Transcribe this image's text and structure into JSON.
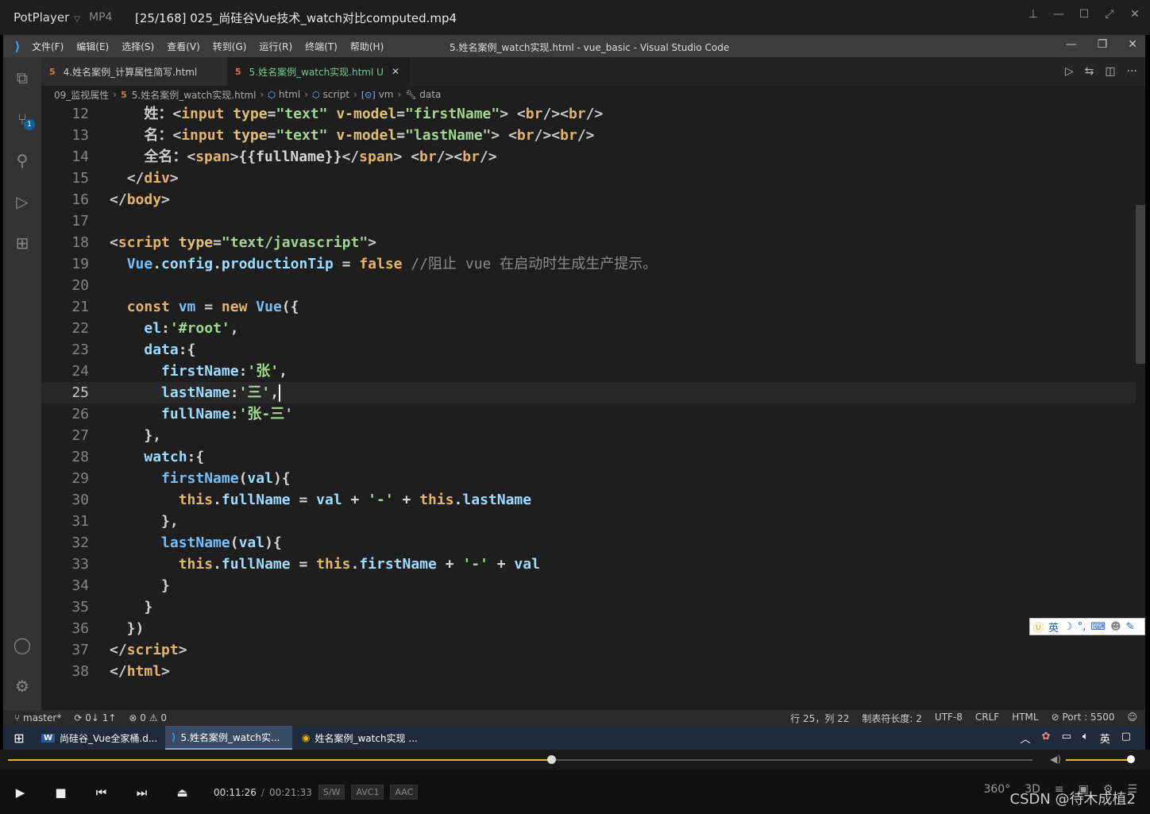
{
  "potplayer": {
    "app_name": "PotPlayer",
    "format": "MP4",
    "file_title": "[25/168] 025_尚硅谷Vue技术_watch对比computed.mp4",
    "current_time": "00:11:26",
    "time_separator": "/",
    "total_time": "00:21:33",
    "codec_badges": [
      "S/W",
      "AVC1",
      "AAC"
    ],
    "progress_fraction": 0.53,
    "volume_fraction": 1.0,
    "right_controls": [
      "360°",
      "3D"
    ]
  },
  "vscode": {
    "menu": [
      "文件(F)",
      "编辑(E)",
      "选择(S)",
      "查看(V)",
      "转到(G)",
      "运行(R)",
      "终端(T)",
      "帮助(H)"
    ],
    "window_title": "5.姓名案例_watch实现.html - vue_basic - Visual Studio Code",
    "tabs": [
      {
        "label": "4.姓名案例_计算属性简写.html",
        "active": false
      },
      {
        "label": "5.姓名案例_watch实现.html U",
        "active": true
      }
    ],
    "breadcrumb": [
      "09_监视属性",
      "5.姓名案例_watch实现.html",
      "html",
      "script",
      "vm",
      "data"
    ],
    "scm_badge": "1",
    "status": {
      "branch": "master*",
      "sync": "0↓ 1↑",
      "errors": "0",
      "warnings": "0",
      "position": "行 25，列 22",
      "indent": "制表符长度: 2",
      "encoding": "UTF-8",
      "eol": "CRLF",
      "language": "HTML",
      "port": "Port : 5500"
    },
    "current_line": 25
  },
  "ime": {
    "label": "英"
  },
  "taskbar": {
    "items": [
      {
        "label": "尚硅谷_Vue全家桶.d...",
        "icon": "word-icon"
      },
      {
        "label": "5.姓名案例_watch实...",
        "icon": "vscode-icon"
      },
      {
        "label": "姓名案例_watch实现 ...",
        "icon": "chrome-icon"
      }
    ],
    "tray_lang": "英"
  },
  "watermark": "CSDN @待木成植2",
  "code_lines": [
    {
      "n": 12,
      "html": "    <span class='tg'>姓：</span><span class='tg'>&lt;</span><span class='tn'>input</span> <span class='at'>type</span>=<span class='st'>\"text\"</span> <span class='at'>v-model</span>=<span class='st'>\"firstName\"</span><span class='tg'>&gt;</span> <span class='tg'>&lt;</span><span class='tn'>br</span><span class='tg'>/&gt;&lt;</span><span class='tn'>br</span><span class='tg'>/&gt;</span>"
    },
    {
      "n": 13,
      "html": "    <span class='tg'>名：</span><span class='tg'>&lt;</span><span class='tn'>input</span> <span class='at'>type</span>=<span class='st'>\"text\"</span> <span class='at'>v-model</span>=<span class='st'>\"lastName\"</span><span class='tg'>&gt;</span> <span class='tg'>&lt;</span><span class='tn'>br</span><span class='tg'>/&gt;&lt;</span><span class='tn'>br</span><span class='tg'>/&gt;</span>"
    },
    {
      "n": 14,
      "html": "    <span class='tg'>全名：</span><span class='tg'>&lt;</span><span class='tn'>span</span><span class='tg'>&gt;</span>{{fullName}}<span class='tg'>&lt;/</span><span class='tn'>span</span><span class='tg'>&gt;</span> <span class='tg'>&lt;</span><span class='tn'>br</span><span class='tg'>/&gt;&lt;</span><span class='tn'>br</span><span class='tg'>/&gt;</span>"
    },
    {
      "n": 15,
      "html": "  <span class='tg'>&lt;/</span><span class='tn'>div</span><span class='tg'>&gt;</span>"
    },
    {
      "n": 16,
      "html": "<span class='tg'>&lt;/</span><span class='tn'>body</span><span class='tg'>&gt;</span>"
    },
    {
      "n": 17,
      "html": ""
    },
    {
      "n": 18,
      "html": "<span class='tg'>&lt;</span><span class='tn'>script</span> <span class='at'>type</span>=<span class='st'>\"text/javascript\"</span><span class='tg'>&gt;</span>"
    },
    {
      "n": 19,
      "html": "  <span class='vr'>Vue</span>.<span class='pr'>config</span>.<span class='pr'>productionTip</span> = <span class='kw'>false</span> <span class='cm'>//阻止 vue 在启动时生成生产提示。</span>"
    },
    {
      "n": 20,
      "html": ""
    },
    {
      "n": 21,
      "html": "  <span class='kw'>const</span> <span class='vr'>vm</span> = <span class='kw'>new</span> <span class='fn'>Vue</span>({"
    },
    {
      "n": 22,
      "html": "    <span class='pr'>el</span>:<span class='st'>'#root'</span>,"
    },
    {
      "n": 23,
      "html": "    <span class='pr'>data</span>:{"
    },
    {
      "n": 24,
      "html": "      <span class='pr'>firstName</span>:<span class='st'>'张'</span>,"
    },
    {
      "n": 25,
      "html": "      <span class='pr'>lastName</span>:<span class='st'>'三'</span>,<span class='cursor'></span>"
    },
    {
      "n": 26,
      "html": "      <span class='pr'>fullName</span>:<span class='st'>'张-三'</span>"
    },
    {
      "n": 27,
      "html": "    },"
    },
    {
      "n": 28,
      "html": "    <span class='pr'>watch</span>:{"
    },
    {
      "n": 29,
      "html": "      <span class='fn'>firstName</span>(<span class='pr'>val</span>){"
    },
    {
      "n": 30,
      "html": "        <span class='kw'>this</span>.<span class='pr'>fullName</span> = <span class='pr'>val</span> + <span class='st'>'-'</span> + <span class='kw'>this</span>.<span class='pr'>lastName</span>"
    },
    {
      "n": 31,
      "html": "      },"
    },
    {
      "n": 32,
      "html": "      <span class='fn'>lastName</span>(<span class='pr'>val</span>){"
    },
    {
      "n": 33,
      "html": "        <span class='kw'>this</span>.<span class='pr'>fullName</span> = <span class='kw'>this</span>.<span class='pr'>firstName</span> + <span class='st'>'-'</span> + <span class='pr'>val</span>"
    },
    {
      "n": 34,
      "html": "      }"
    },
    {
      "n": 35,
      "html": "    }"
    },
    {
      "n": 36,
      "html": "  })"
    },
    {
      "n": 37,
      "html": "<span class='tg'>&lt;/</span><span class='tn'>script</span><span class='tg'>&gt;</span>"
    },
    {
      "n": 38,
      "html": "<span class='tg'>&lt;/</span><span class='tn'>html</span><span class='tg'>&gt;</span>"
    }
  ]
}
